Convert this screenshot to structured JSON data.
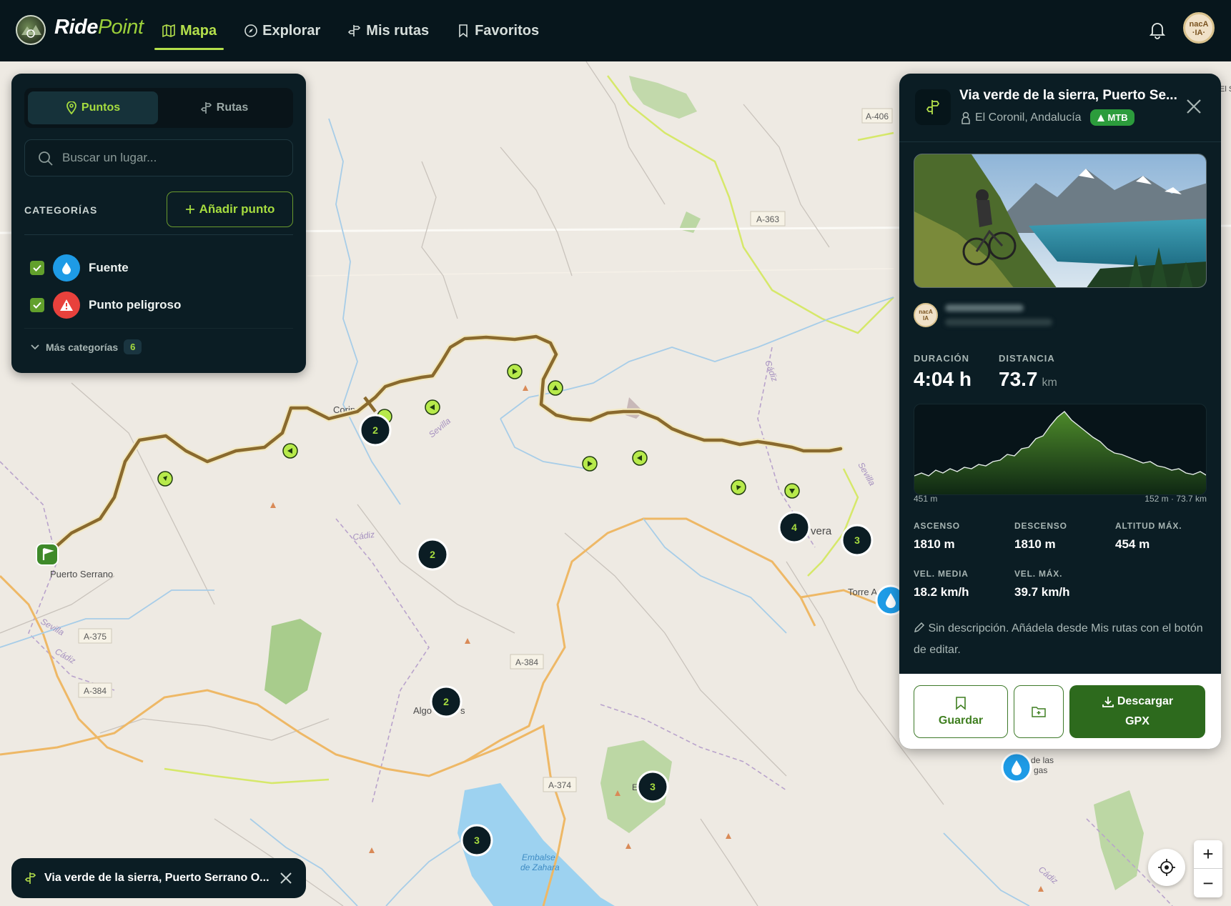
{
  "brand": {
    "name_part1": "Ride",
    "name_part2": "Point"
  },
  "nav": {
    "items": [
      {
        "label": "Mapa",
        "icon": "map-icon",
        "active": true
      },
      {
        "label": "Explorar",
        "icon": "compass-icon",
        "active": false
      },
      {
        "label": "Mis rutas",
        "icon": "signpost-icon",
        "active": false
      },
      {
        "label": "Favoritos",
        "icon": "bookmark-icon",
        "active": false
      }
    ]
  },
  "user": {
    "avatar_text_1": "nacA",
    "avatar_text_2": "IA"
  },
  "left_panel": {
    "tabs": [
      {
        "label": "Puntos",
        "active": true
      },
      {
        "label": "Rutas",
        "active": false
      }
    ],
    "search_placeholder": "Buscar un lugar...",
    "categories_title": "CATEGORÍAS",
    "add_point_label": "Añadir punto",
    "categories": [
      {
        "label": "Fuente",
        "checked": true,
        "color": "#1e9be6",
        "icon": "water-drop-icon"
      },
      {
        "label": "Punto peligroso",
        "checked": true,
        "color": "#e8413c",
        "icon": "warning-icon"
      }
    ],
    "more_label": "Más categorías",
    "more_count": "6"
  },
  "map": {
    "labels": {
      "coripe": "Coripe",
      "puerto_serrano": "Puerto Serrano",
      "olvera_partial": "vera",
      "algo_partial": "Algo",
      "algo_partial2": "s",
      "torre": "Torre A",
      "de_las": "de las",
      "gas": "gas",
      "embalse": "Embalse",
      "de_zahara": "de Zahara",
      "e_partial": "E",
      "cadiz1": "Cádiz",
      "cadiz2": "Cádiz",
      "cadiz3": "Cádiz",
      "cadiz4": "Cádiz",
      "sevilla1": "Sevilla",
      "sevilla2": "Sevilla",
      "sevilla3": "Sevilla",
      "el_s": "El S"
    },
    "roads": [
      "A-406",
      "A-363",
      "A-375",
      "A-384",
      "A-384",
      "A-374"
    ],
    "clusters": [
      "2",
      "2",
      "4",
      "3",
      "2",
      "3",
      "3"
    ],
    "colors": {
      "route": "#8a6a2e",
      "route_outline": "#f2e8c0",
      "marker": "#b7ea4b",
      "cluster_bg": "#0b1d24",
      "cluster_text": "#a6dc3f",
      "water_marker": "#1e9be6"
    }
  },
  "route_panel": {
    "title": "Via verde de la sierra, Puerto Se...",
    "location": "El Coronil, Andalucía",
    "badge": "MTB",
    "stats": {
      "duration_label": "DURACIÓN",
      "duration_value": "4:04 h",
      "distance_label": "DISTANCIA",
      "distance_value": "73.7",
      "distance_unit": "km",
      "elev_start": "451 m",
      "elev_end": "152 m · 73.7 km",
      "ascent_label": "ASCENSO",
      "ascent_value": "1810 m",
      "descent_label": "DESCENSO",
      "descent_value": "1810 m",
      "max_alt_label": "ALTITUD MÁX.",
      "max_alt_value": "454 m",
      "avg_speed_label": "VEL. MEDIA",
      "avg_speed_value": "18.2 km/h",
      "max_speed_label": "VEL. MÁX.",
      "max_speed_value": "39.7 km/h"
    },
    "description": "Sin descripción. Añádela desde Mis rutas con el botón de editar.",
    "save_label": "Guardar",
    "gpx_label_1": "Descargar",
    "gpx_label_2": "GPX"
  },
  "bottom_pill": {
    "label": "Via verde de la sierra, Puerto Serrano O..."
  },
  "zoom": {
    "in": "+",
    "out": "−"
  }
}
